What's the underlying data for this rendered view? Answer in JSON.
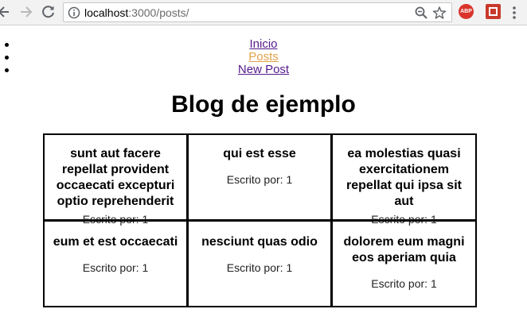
{
  "browser": {
    "url_host": "localhost",
    "url_rest": ":3000/posts/",
    "extension_abp": "ABP"
  },
  "nav": {
    "items": [
      {
        "label": "Inicio"
      },
      {
        "label": "Posts"
      },
      {
        "label": "New Post"
      }
    ]
  },
  "page": {
    "title": "Blog de ejemplo"
  },
  "posts": [
    {
      "title": "sunt aut facere repellat provident occaecati excepturi optio reprehenderit",
      "author": "Escrito por: 1"
    },
    {
      "title": "qui est esse",
      "author": "Escrito por: 1"
    },
    {
      "title": "ea molestias quasi exercitationem repellat qui ipsa sit aut",
      "author": "Escrito por: 1"
    },
    {
      "title": "eum et est occaecati",
      "author": "Escrito por: 1"
    },
    {
      "title": "nesciunt quas odio",
      "author": "Escrito por: 1"
    },
    {
      "title": "dolorem eum magni eos aperiam quia",
      "author": "Escrito por: 1"
    }
  ]
}
